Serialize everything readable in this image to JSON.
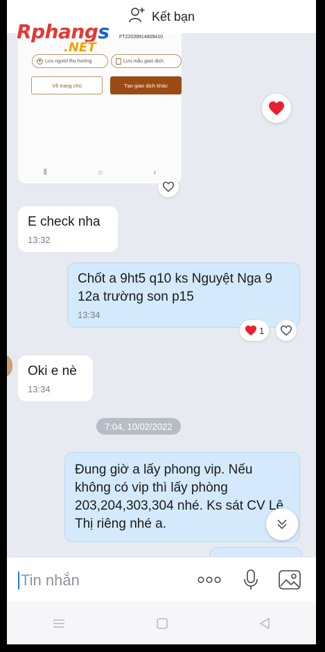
{
  "header": {
    "action_label": "Kết bạn"
  },
  "watermark": {
    "main": "Rphang",
    "main_tail": "s",
    "sub": ".NET"
  },
  "shared_image": {
    "transaction_id": "FT22039914809410",
    "save_recipient_label": "Lưu người thụ hưởng",
    "save_template_label": "Lưu mẫu giao dịch",
    "home_button": "Về trang chủ",
    "new_transaction_button": "Tạo giao dịch khác"
  },
  "messages": [
    {
      "direction": "in",
      "text": "E check nha",
      "time": "13:32"
    },
    {
      "direction": "out",
      "text": "Chốt a 9ht5 q10 ks Nguyệt Nga 9 12a trường son p15",
      "time": "13:34"
    },
    {
      "direction": "in",
      "text": "Oki e nè",
      "time": "13:34"
    },
    {
      "direction": "out",
      "text": "Đung giờ a lấy phong vip. Nếu không có vip thì lấy phòng 203,204,303,304 nhé. Ks sát CV Lê Thị riêng nhé a."
    }
  ],
  "reaction": {
    "count": "1"
  },
  "date_separator": "7:04, 10/02/2022",
  "composer": {
    "placeholder": "Tin nhắn"
  },
  "icons": {
    "add_friend": "add-user-icon",
    "heart": "heart-icon",
    "like": "heart-outline-icon",
    "more": "more-icon",
    "mic": "microphone-icon",
    "image": "image-icon",
    "scroll": "chevron-double-down-icon"
  },
  "colors": {
    "heart": "#e8202f",
    "outgoing_bubble": "#d4e9fb",
    "background": "#e7eaf0",
    "accent": "#1e7be0"
  }
}
